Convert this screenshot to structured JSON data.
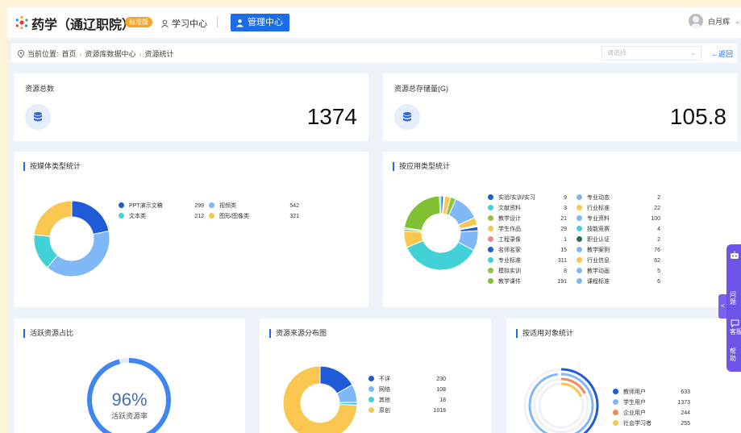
{
  "header": {
    "app_title": "药学（通辽职院）",
    "version_badge": "标准版",
    "nav_learning": "学习中心",
    "nav_management": "管理中心",
    "user_name": "白月辉"
  },
  "breadcrumb": {
    "prefix": "当前位置:",
    "items": [
      "首页",
      "资源库数据中心",
      "资源统计"
    ],
    "select_placeholder": "请选择",
    "back_label": "←返回"
  },
  "stats": {
    "total_label": "资源总数",
    "total_value": "1374",
    "storage_label": "资源总存储量(G)",
    "storage_value": "105.8"
  },
  "media_type": {
    "title": "按媒体类型统计",
    "items": [
      {
        "name": "PPT演示文稿",
        "value": "299",
        "color": "#1f5bd6"
      },
      {
        "name": "视频类",
        "value": "542",
        "color": "#7fb8f7"
      },
      {
        "name": "文本类",
        "value": "212",
        "color": "#41d1d6"
      },
      {
        "name": "图形/图像类",
        "value": "321",
        "color": "#f9c74f"
      }
    ]
  },
  "application_type": {
    "title": "按应用类型统计",
    "items": [
      {
        "name": "实验/实训/实习",
        "value": "9",
        "color": "#1f5bd6"
      },
      {
        "name": "专业动态",
        "value": "2",
        "color": "#7fb8f7"
      },
      {
        "name": "文献资料",
        "value": "3",
        "color": "#41d1d6"
      },
      {
        "name": "行业标准",
        "value": "22",
        "color": "#f9c74f"
      },
      {
        "name": "教学设计",
        "value": "21",
        "color": "#8cc63f"
      },
      {
        "name": "专业资料",
        "value": "100",
        "color": "#7fb8f7"
      },
      {
        "name": "学生作品",
        "value": "29",
        "color": "#f9c74f"
      },
      {
        "name": "技能竞赛",
        "value": "4",
        "color": "#41d1d6"
      },
      {
        "name": "工程录像",
        "value": "1",
        "color": "#f08a8a"
      },
      {
        "name": "职业认证",
        "value": "2",
        "color": "#2f6b53"
      },
      {
        "name": "名师名家",
        "value": "15",
        "color": "#1f5bd6"
      },
      {
        "name": "教学案例",
        "value": "76",
        "color": "#7fb8f7"
      },
      {
        "name": "专业标准",
        "value": "311",
        "color": "#41d1d6"
      },
      {
        "name": "行业信息",
        "value": "62",
        "color": "#f9c74f"
      },
      {
        "name": "模拟实训",
        "value": "8",
        "color": "#8cc63f"
      },
      {
        "name": "教学动画",
        "value": "5",
        "color": "#7fb8f7"
      },
      {
        "name": "教学课件",
        "value": "191",
        "color": "#7ec234"
      },
      {
        "name": "课程标准",
        "value": "6",
        "color": "#7fb8f7"
      }
    ]
  },
  "active_resources": {
    "title": "活跃资源占比",
    "percent_text": "96%",
    "percent": 96,
    "subtitle": "活跃资源率"
  },
  "source_distribution": {
    "title": "资源来源分布图",
    "items": [
      {
        "name": "不详",
        "value": "230",
        "color": "#1f5bd6"
      },
      {
        "name": "网络",
        "value": "108",
        "color": "#7fb8f7"
      },
      {
        "name": "其他",
        "value": "18",
        "color": "#41d1d6"
      },
      {
        "name": "原创",
        "value": "1018",
        "color": "#f9c74f"
      }
    ]
  },
  "audience": {
    "title": "按适用对象统计",
    "items": [
      {
        "name": "教师用户",
        "value": "633",
        "color": "#1f5bd6"
      },
      {
        "name": "学生用户",
        "value": "1373",
        "color": "#7fb8f7"
      },
      {
        "name": "企业用户",
        "value": "244",
        "color": "#f08a5d"
      },
      {
        "name": "社会学习者",
        "value": "255",
        "color": "#f9c74f"
      }
    ]
  },
  "float_panel": {
    "item1": "问题反馈",
    "item2": "客服",
    "item3": "帮助中心",
    "tab": "<"
  },
  "colors": {
    "primary": "#1a6ce8",
    "badge": "#f5a623",
    "float_panel": "#6f52e8"
  }
}
